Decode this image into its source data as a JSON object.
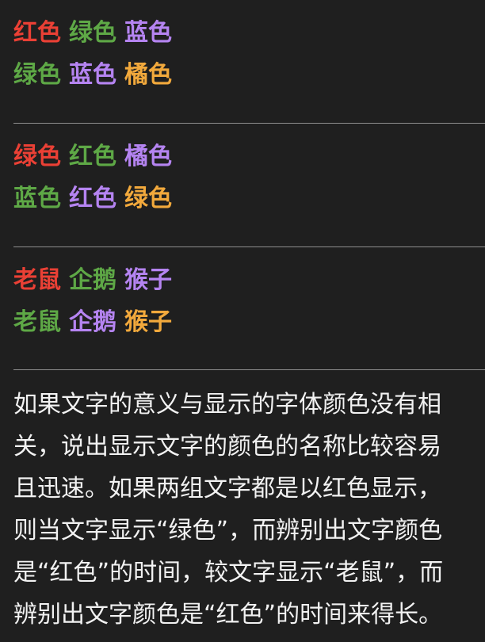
{
  "colors": {
    "red": "#ea4035",
    "green": "#5ea846",
    "purple": "#b584f1",
    "orange": "#f2a93c",
    "text": "#f2f2f2",
    "divider": "#8d8d8d",
    "background": "#1f1f1f"
  },
  "groups": [
    {
      "rows": [
        [
          {
            "text": "红色",
            "color": "red"
          },
          {
            "text": "绿色",
            "color": "green"
          },
          {
            "text": "蓝色",
            "color": "purple"
          }
        ],
        [
          {
            "text": "绿色",
            "color": "green"
          },
          {
            "text": "蓝色",
            "color": "purple"
          },
          {
            "text": "橘色",
            "color": "orange"
          }
        ]
      ]
    },
    {
      "rows": [
        [
          {
            "text": "绿色",
            "color": "red"
          },
          {
            "text": "红色",
            "color": "green"
          },
          {
            "text": "橘色",
            "color": "purple"
          }
        ],
        [
          {
            "text": "蓝色",
            "color": "green"
          },
          {
            "text": "红色",
            "color": "purple"
          },
          {
            "text": "绿色",
            "color": "orange"
          }
        ]
      ]
    },
    {
      "rows": [
        [
          {
            "text": "老鼠",
            "color": "red"
          },
          {
            "text": "企鹅",
            "color": "green"
          },
          {
            "text": "猴子",
            "color": "purple"
          }
        ],
        [
          {
            "text": "老鼠",
            "color": "green"
          },
          {
            "text": "企鹅",
            "color": "purple"
          },
          {
            "text": "猴子",
            "color": "orange"
          }
        ]
      ]
    }
  ],
  "paragraph_lines": [
    "如果文字的意义与显示的字体颜色没有相",
    "关，说出显示文字的颜色的名称比较容易",
    "且迅速。如果两组文字都是以红色显示，",
    "则当文字显示“绿色”，而辨别出文字颜色",
    "是“红色”的时间，较文字显示“老鼠”，而",
    "辨别出文字颜色是“红色”的时间来得长。"
  ]
}
